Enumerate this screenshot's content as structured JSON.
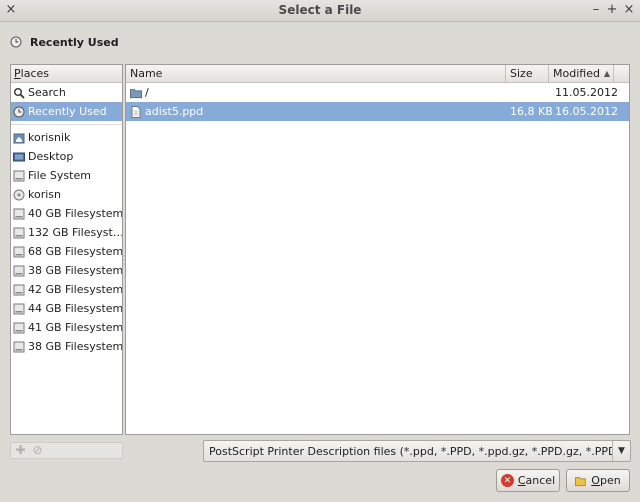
{
  "window": {
    "title": "Select a File"
  },
  "location": {
    "label": "Recently Used"
  },
  "places": {
    "header": "Places",
    "items": [
      {
        "label": "Search",
        "icon": "search-icon"
      },
      {
        "label": "Recently Used",
        "icon": "clock-icon",
        "selected": true
      },
      {
        "label": "korisnik",
        "icon": "home-folder-icon"
      },
      {
        "label": "Desktop",
        "icon": "desktop-icon"
      },
      {
        "label": "File System",
        "icon": "drive-icon"
      },
      {
        "label": "korisn",
        "icon": "drive-icon"
      },
      {
        "label": "40 GB Filesystem",
        "icon": "drive-icon"
      },
      {
        "label": "132 GB Filesyst…",
        "icon": "drive-icon"
      },
      {
        "label": "68 GB Filesystem",
        "icon": "drive-icon"
      },
      {
        "label": "38 GB Filesystem",
        "icon": "drive-icon"
      },
      {
        "label": "42 GB Filesystem",
        "icon": "drive-icon"
      },
      {
        "label": "44 GB Filesystem",
        "icon": "drive-icon"
      },
      {
        "label": "41 GB Filesystem",
        "icon": "drive-icon"
      },
      {
        "label": "38 GB Filesystem",
        "icon": "drive-icon"
      }
    ]
  },
  "files": {
    "columns": {
      "name": "Name",
      "size": "Size",
      "modified": "Modified"
    },
    "rows": [
      {
        "name": "/",
        "size": "",
        "modified": "11.05.2012",
        "icon": "folder-icon"
      },
      {
        "name": "adist5.ppd",
        "size": "16,8 KB",
        "modified": "16.05.2012",
        "icon": "file-icon",
        "selected": true
      }
    ]
  },
  "filter": {
    "value": "PostScript Printer Description files (*.ppd, *.PPD, *.ppd.gz, *.PPD.gz, *.PPD.GZ)"
  },
  "buttons": {
    "cancel": "Cancel",
    "open": "Open"
  },
  "colors": {
    "selection": "#86abd9",
    "cancel_icon": "#d23b2f",
    "open_icon": "#e8c54a"
  }
}
